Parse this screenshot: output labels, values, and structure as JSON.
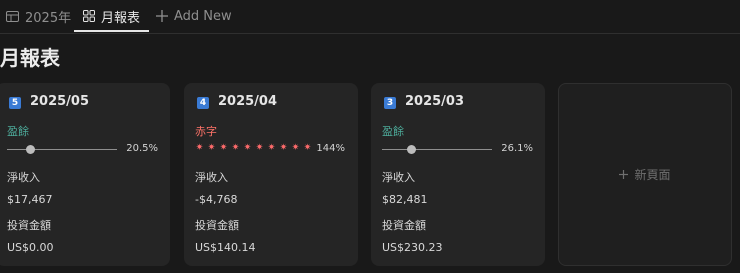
{
  "tabs": [
    {
      "label": "2025年",
      "icon": "table-icon"
    },
    {
      "label": "月報表",
      "icon": "gallery-icon"
    },
    {
      "label": "Add New",
      "icon": "plus-icon"
    }
  ],
  "page_title": "月報表",
  "cards": [
    {
      "badge": "5",
      "title": "2025/05",
      "status": "盈餘",
      "progress": 0.205,
      "percent": "20.5%",
      "net_label": "淨收入",
      "net_value": "$17,467",
      "invest_label": "投資金額",
      "invest_value": "US$0.00"
    },
    {
      "badge": "4",
      "title": "2025/04",
      "status": "赤字",
      "stars": 10,
      "percent": "144%",
      "net_label": "淨收入",
      "net_value": "-$4,768",
      "invest_label": "投資金額",
      "invest_value": "US$140.14"
    },
    {
      "badge": "3",
      "title": "2025/03",
      "status": "盈餘",
      "progress": 0.261,
      "percent": "26.1%",
      "net_label": "淨收入",
      "net_value": "$82,481",
      "invest_label": "投資金額",
      "invest_value": "US$230.23"
    }
  ],
  "new_page_label": "新頁面",
  "colors": {
    "background": "#191919",
    "card": "#252525",
    "surplus": "#4dab9a",
    "deficit": "#ff7369",
    "badge": "#3a7bd5"
  }
}
